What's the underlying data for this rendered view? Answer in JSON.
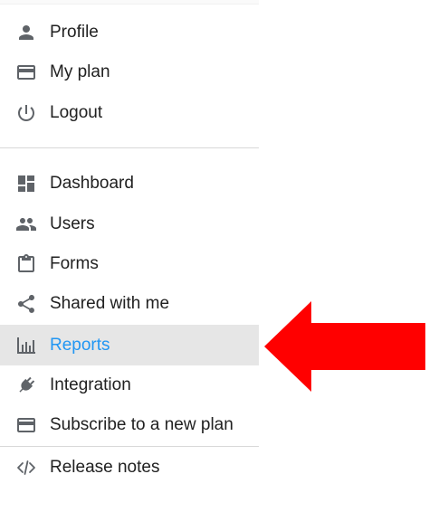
{
  "colors": {
    "icon": "#5f6368",
    "text": "#212121",
    "active_text": "#2196f3",
    "active_background": "#e6e6e6",
    "divider": "#d8d8d8",
    "callout_arrow": "#ff0000"
  },
  "account_menu": {
    "items": [
      {
        "label": "Profile",
        "icon": "person-icon"
      },
      {
        "label": "My plan",
        "icon": "credit-card-icon"
      },
      {
        "label": "Logout",
        "icon": "power-icon"
      }
    ]
  },
  "navigation_menu": {
    "selected_item": "Reports",
    "items": [
      {
        "label": "Dashboard",
        "icon": "dashboard-icon"
      },
      {
        "label": "Users",
        "icon": "people-icon"
      },
      {
        "label": "Forms",
        "icon": "clipboard-icon"
      },
      {
        "label": "Shared with me",
        "icon": "share-icon"
      },
      {
        "label": "Reports",
        "icon": "bar-chart-icon"
      },
      {
        "label": "Integration",
        "icon": "plug-icon"
      },
      {
        "label": "Subscribe to a new plan",
        "icon": "credit-card-icon"
      }
    ]
  },
  "footer_menu": {
    "items": [
      {
        "label": "Release notes",
        "icon": "code-icon"
      }
    ]
  }
}
